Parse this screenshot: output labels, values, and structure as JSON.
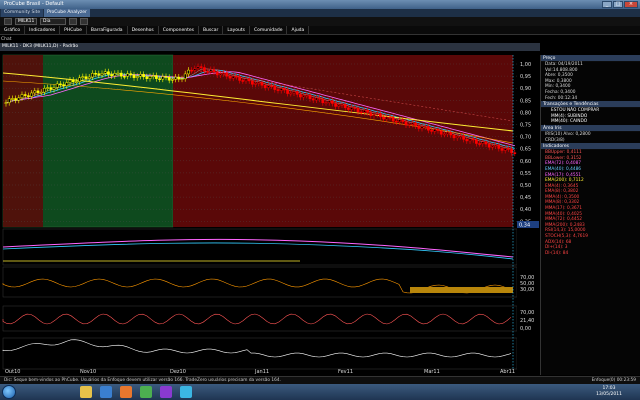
{
  "window": {
    "title": "ProCube Brasil - Default",
    "min": "_",
    "max": "□",
    "close": "×"
  },
  "tabs": [
    "Community Site",
    "ProCube Analyzer"
  ],
  "toolbar": {
    "symbol": "MILK11",
    "period": "Dia"
  },
  "menu": [
    "Gráfico",
    "Indicadores",
    "PHCube",
    "BarraFigurada",
    "Desenhos",
    "Componentes",
    "Buscar",
    "Layouts",
    "Comunidade",
    "Ajuda"
  ],
  "chart": {
    "label": "Chat",
    "header": "MILK11 · DK3 (MILK11,D) - Padrão",
    "price_ticks": [
      "1,00",
      "0,95",
      "0,90",
      "0,85",
      "0,80",
      "0,75",
      "0,70",
      "0,65",
      "0,60",
      "0,55",
      "0,50",
      "0,45",
      "0,40",
      "0,35"
    ],
    "last_price": "0,34",
    "osc1_ticks": [
      "70,00",
      "50,00",
      "30,00"
    ],
    "osc2_ticks": [
      "70,00",
      "21,40",
      "0,00"
    ],
    "time_labels": [
      "Out10",
      "Nov10",
      "Dez10",
      "Jan11",
      "Fev11",
      "Mar11",
      "Abr11"
    ]
  },
  "right_panel": {
    "price": {
      "header": "Preço",
      "rows": [
        "Data: 04/19/2011",
        "Vol:14.808.800",
        "Abre: 0,3500",
        "Max: 0,3800",
        "Min: 0,3400",
        "Fecha: 0,3400",
        "Fech: 00:12:34"
      ]
    },
    "signals": {
      "header": "Transações e Tendências",
      "rows": [
        "ESTOU NÃO COMPRAR",
        "MM(4): SUBINDO",
        "MM(40): CAINDO"
      ]
    },
    "area": {
      "header": "Área Iris",
      "rows": [
        "IRIS(10) Alvo: 0,2800",
        "CRD(3/8)"
      ]
    },
    "indicators": {
      "header": "Indicadores",
      "rows": [
        {
          "text": "BBUpper: 0,4111",
          "color": "#ff5555"
        },
        {
          "text": "BBLower: 0,3152",
          "color": "#ff5555"
        },
        {
          "text": "EMA(72): 0,4087",
          "color": "#ff66ff"
        },
        {
          "text": "EMA(40): 0,4486",
          "color": "#66ccff"
        },
        {
          "text": "EMA(17): 0,4551",
          "color": "#ff66ff"
        },
        {
          "text": "EMA(200): 0,7112",
          "color": "#ffee33"
        },
        {
          "text": "EMA(4): 0,3645",
          "color": "#ff4444"
        },
        {
          "text": "EMA(8): 0,3802",
          "color": "#ff4444"
        },
        {
          "text": "MMA(4): 0,3500",
          "color": "#ff4444"
        },
        {
          "text": "MMA(8): 0,3302",
          "color": "#ff4444"
        },
        {
          "text": "MMA(17): 0,3671",
          "color": "#ff4444"
        },
        {
          "text": "MMA(40): 0,4025",
          "color": "#ff4444"
        },
        {
          "text": "MMA(72): 0,4452",
          "color": "#ff4444"
        },
        {
          "text": "MMA(200): 0,2483",
          "color": "#ff4444"
        },
        {
          "text": "RSI(14,3): 15,0000",
          "color": "#ff4444"
        },
        {
          "text": "STOCH(5,3): 4,7619",
          "color": "#ff4444"
        },
        {
          "text": "ADX(14): 68",
          "color": "#ff4444"
        },
        {
          "text": "DI+(14): 3",
          "color": "#ff4444"
        },
        {
          "text": "DI-(14): 84",
          "color": "#ff4444"
        }
      ]
    }
  },
  "status": {
    "text": "Dic: Seque bem-vindos ao PhCube. Usuários da Enfoque devem utilizar versão 166. TradeZero usuários precisam da versão 164.",
    "right": "Enfoque(0)   00:23:59"
  },
  "taskbar": {
    "time": "17:03",
    "date": "13/05/2011"
  },
  "colors": {
    "buy_zone": "#0e4a1e",
    "sell_zone": "#5a0808",
    "up_candle": "#ffff00",
    "down_candle": "#ff0000",
    "ema200": "#ffee33",
    "ema72": "#ff66ff",
    "ema40": "#33ccff",
    "ema_other": "#ffaa00"
  }
}
